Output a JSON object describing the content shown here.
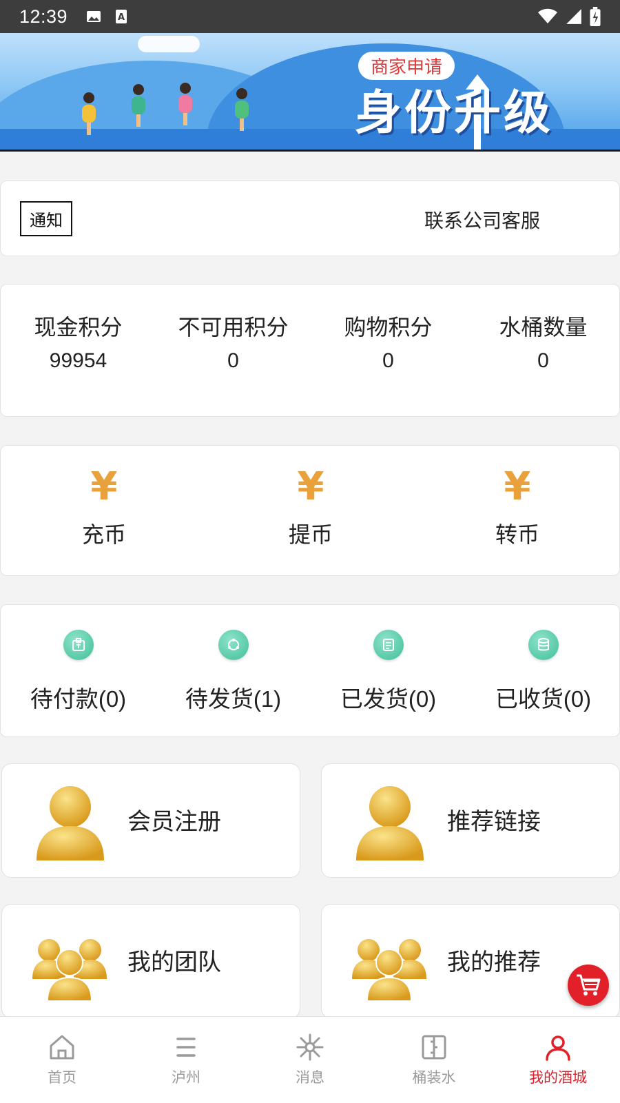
{
  "status_bar": {
    "time": "12:39",
    "icons_left": [
      "image-icon",
      "font-a-icon"
    ],
    "icons_right": [
      "wifi-icon",
      "signal-icon",
      "battery-charging-icon"
    ]
  },
  "banner": {
    "tag": "商家申请",
    "title": "身份升级"
  },
  "notice": {
    "tag": "通知",
    "contact": "联系公司客服"
  },
  "points": [
    {
      "label": "现金积分",
      "value": "99954"
    },
    {
      "label": "不可用积分",
      "value": "0"
    },
    {
      "label": "购物积分",
      "value": "0"
    },
    {
      "label": "水桶数量",
      "value": "0"
    }
  ],
  "coins": [
    {
      "icon": "yen-icon",
      "symbol": "¥",
      "label": "充币"
    },
    {
      "icon": "yen-icon",
      "symbol": "¥",
      "label": "提币"
    },
    {
      "icon": "yen-icon",
      "symbol": "¥",
      "label": "转币"
    }
  ],
  "orders": [
    {
      "icon": "wallet-icon",
      "label": "待付款(0)"
    },
    {
      "icon": "refresh-icon",
      "label": "待发货(1)"
    },
    {
      "icon": "document-icon",
      "label": "已发货(0)"
    },
    {
      "icon": "database-icon",
      "label": "已收货(0)"
    }
  ],
  "tiles": [
    {
      "icon": "user-avatar-icon",
      "label": "会员注册"
    },
    {
      "icon": "user-avatar-icon",
      "label": "推荐链接"
    },
    {
      "icon": "group-avatar-icon",
      "label": "我的团队"
    },
    {
      "icon": "group-avatar-icon",
      "label": "我的推荐"
    }
  ],
  "fab": {
    "icon": "cart-icon"
  },
  "bottom_nav": [
    {
      "icon": "home-icon",
      "label": "首页",
      "active": false
    },
    {
      "icon": "menu-icon",
      "label": "泸州",
      "active": false
    },
    {
      "icon": "sparkle-icon",
      "label": "消息",
      "active": false
    },
    {
      "icon": "barrel-icon",
      "label": "桶装水",
      "active": false
    },
    {
      "icon": "person-icon",
      "label": "我的酒城",
      "active": true
    }
  ],
  "colors": {
    "accent_red": "#e2202a",
    "yen_orange": "#e9a23b",
    "order_green": "#3fbf9a",
    "nav_gray": "#9a9a9a"
  }
}
